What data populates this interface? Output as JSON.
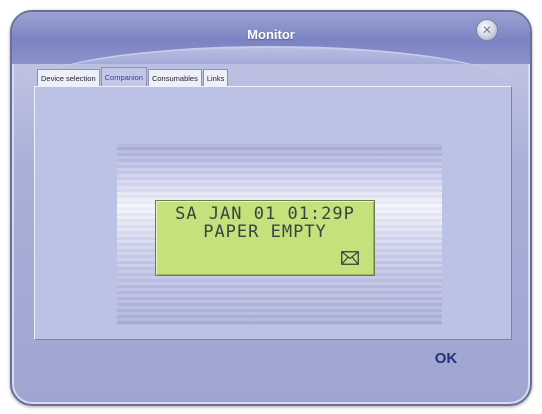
{
  "window": {
    "title": "Monitor",
    "close_icon": "close-icon"
  },
  "tabs": [
    {
      "label": "Device selection",
      "active": false
    },
    {
      "label": "Companion",
      "active": true
    },
    {
      "label": "Consumables",
      "active": false
    },
    {
      "label": "Links",
      "active": false
    }
  ],
  "lcd": {
    "line1": "SA JAN 01 01:29P",
    "line2": "PAPER EMPTY",
    "icon": "mail-envelope-icon",
    "background_color": "#c3e27c",
    "text_color": "#3a4340"
  },
  "footer": {
    "ok_label": "OK"
  },
  "colors": {
    "accent": "#2d3fb8",
    "title_bar": "#7b84c2",
    "panel": "#bcc1e6"
  }
}
